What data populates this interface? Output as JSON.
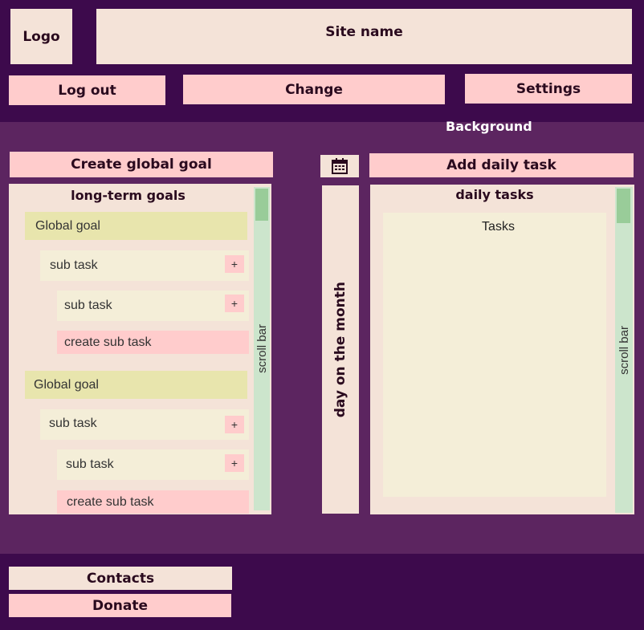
{
  "header": {
    "logo": "Logo",
    "site_name": "Site name",
    "logout": "Log out",
    "change": "Change",
    "settings": "Settings"
  },
  "background_label": "Background",
  "goals": {
    "create_button": "Create global goal",
    "panel_title": "long-term goals",
    "scroll_label": "scroll bar",
    "groups": [
      {
        "global_goal": "Global goal",
        "sub_task_1": "sub task",
        "sub_task_2": "sub task",
        "create_sub_task": "create sub task",
        "plus_1": "+",
        "plus_2": "+"
      },
      {
        "global_goal": "Global goal",
        "sub_task_1": "sub task",
        "sub_task_2": "sub task",
        "create_sub_task": "create sub task",
        "plus_1": "+",
        "plus_2": "+"
      }
    ]
  },
  "calendar": {
    "icon": "calendar-icon",
    "day_label": "day on the month"
  },
  "daily": {
    "add_button": "Add daily task",
    "panel_title": "daily tasks",
    "tasks_label": "Tasks",
    "scroll_label": "scroll bar"
  },
  "footer": {
    "contacts": "Contacts",
    "donate": "Donate"
  }
}
